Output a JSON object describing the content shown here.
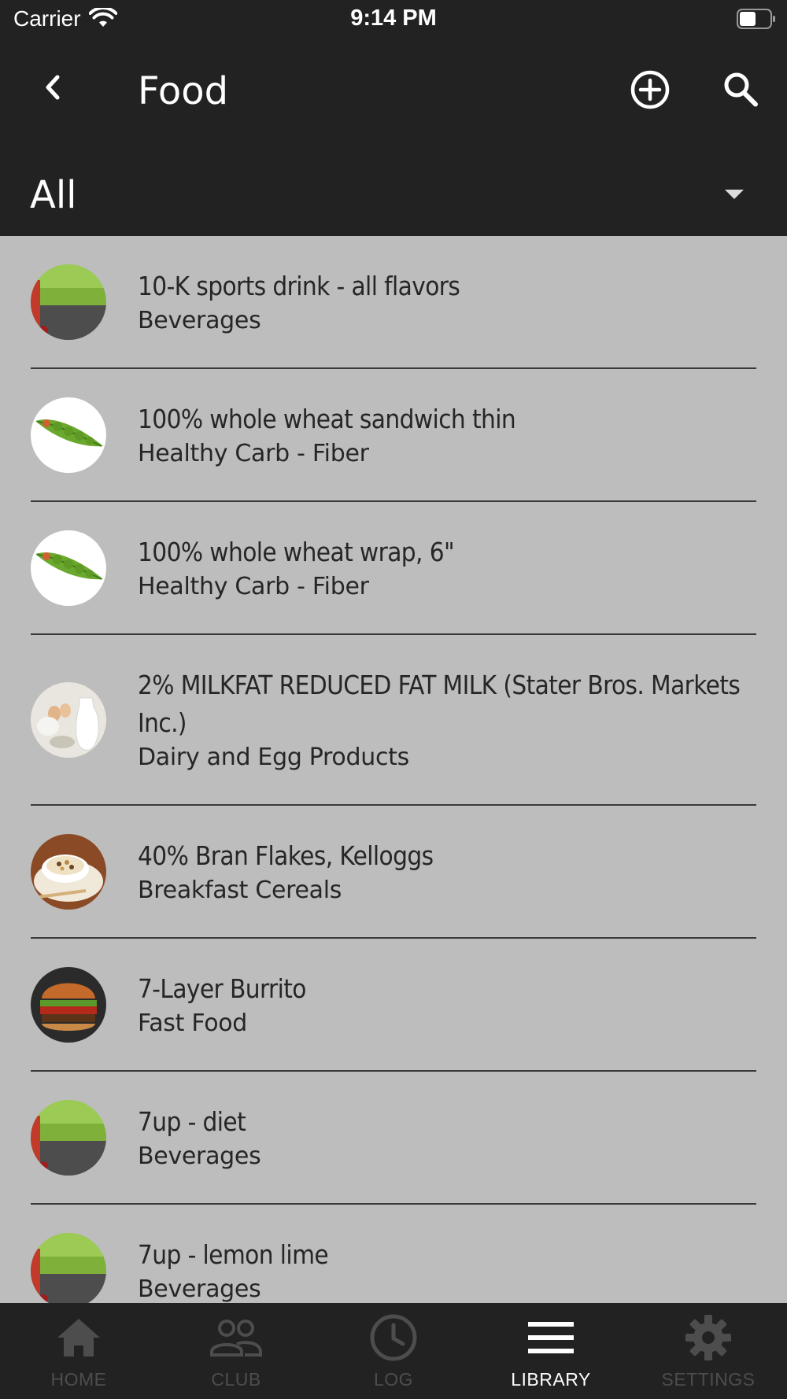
{
  "status_bar": {
    "carrier": "Carrier",
    "time": "9:14 PM"
  },
  "header": {
    "title": "Food",
    "back_icon": "chevron-left-icon",
    "add_icon": "plus-circle-icon",
    "search_icon": "search-icon"
  },
  "filter": {
    "selected": "All"
  },
  "foods": [
    {
      "name": "10-K sports drink - all flavors",
      "category": "Beverages",
      "thumb": "beverage"
    },
    {
      "name": "100% whole wheat sandwich thin",
      "category": "Healthy Carb - Fiber",
      "thumb": "peas"
    },
    {
      "name": "100% whole wheat wrap, 6\"",
      "category": "Healthy Carb - Fiber",
      "thumb": "peas"
    },
    {
      "name": "2% MILKFAT REDUCED FAT MILK (Stater Bros. Markets Inc.)",
      "category": "Dairy and Egg Products",
      "thumb": "dairy"
    },
    {
      "name": "40% Bran Flakes, Kelloggs",
      "category": "Breakfast Cereals",
      "thumb": "cereal"
    },
    {
      "name": "7-Layer Burrito",
      "category": "Fast Food",
      "thumb": "burger"
    },
    {
      "name": "7up -  diet",
      "category": "Beverages",
      "thumb": "beverage"
    },
    {
      "name": "7up - lemon lime",
      "category": "Beverages",
      "thumb": "beverage"
    }
  ],
  "tabs": [
    {
      "label": "HOME",
      "icon": "home-icon",
      "active": false
    },
    {
      "label": "CLUB",
      "icon": "people-icon",
      "active": false
    },
    {
      "label": "LOG",
      "icon": "clock-icon",
      "active": false
    },
    {
      "label": "LIBRARY",
      "icon": "menu-icon",
      "active": true
    },
    {
      "label": "SETTINGS",
      "icon": "gear-icon",
      "active": false
    }
  ],
  "colors": {
    "header_bg": "#222222",
    "list_bg": "#bdbdbd",
    "active_tab": "#ffffff",
    "inactive_tab": "#4d4d4d"
  }
}
